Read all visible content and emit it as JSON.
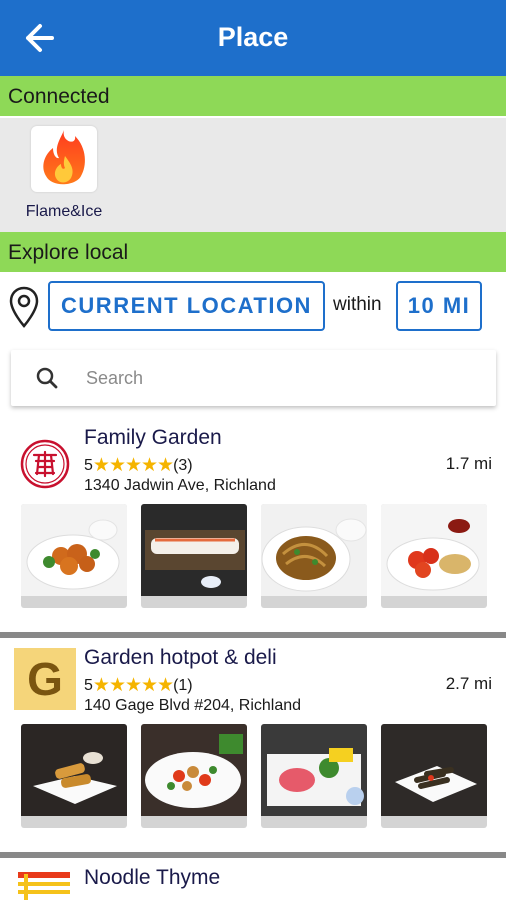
{
  "header": {
    "title": "Place"
  },
  "connected": {
    "section_label": "Connected",
    "apps": [
      {
        "label": "Flame&Ice",
        "icon": "flame-icon"
      }
    ]
  },
  "explore": {
    "section_label": "Explore local",
    "location_button": "CURRENT LOCATION",
    "within_label": "within",
    "distance_button": "10 MI"
  },
  "search": {
    "placeholder": "Search"
  },
  "restaurants": [
    {
      "name": "Family Garden",
      "rating": "5",
      "stars": "★★★★★",
      "reviews": "(3)",
      "distance": "1.7 mi",
      "address": "1340 Jadwin Ave, Richland",
      "logo": "red-seal-logo"
    },
    {
      "name": "Garden hotpot & deli",
      "rating": "5",
      "stars": "★★★★★",
      "reviews": "(1)",
      "distance": "2.7 mi",
      "address": "140 Gage Blvd #204, Richland",
      "logo": "G"
    },
    {
      "name": "Noodle Thyme",
      "logo": "noodle-logo"
    }
  ],
  "colors": {
    "app_bar": "#1e6fcb",
    "section_bar": "#8ed957",
    "star": "#f5b400",
    "accent": "#1e6fcb"
  }
}
